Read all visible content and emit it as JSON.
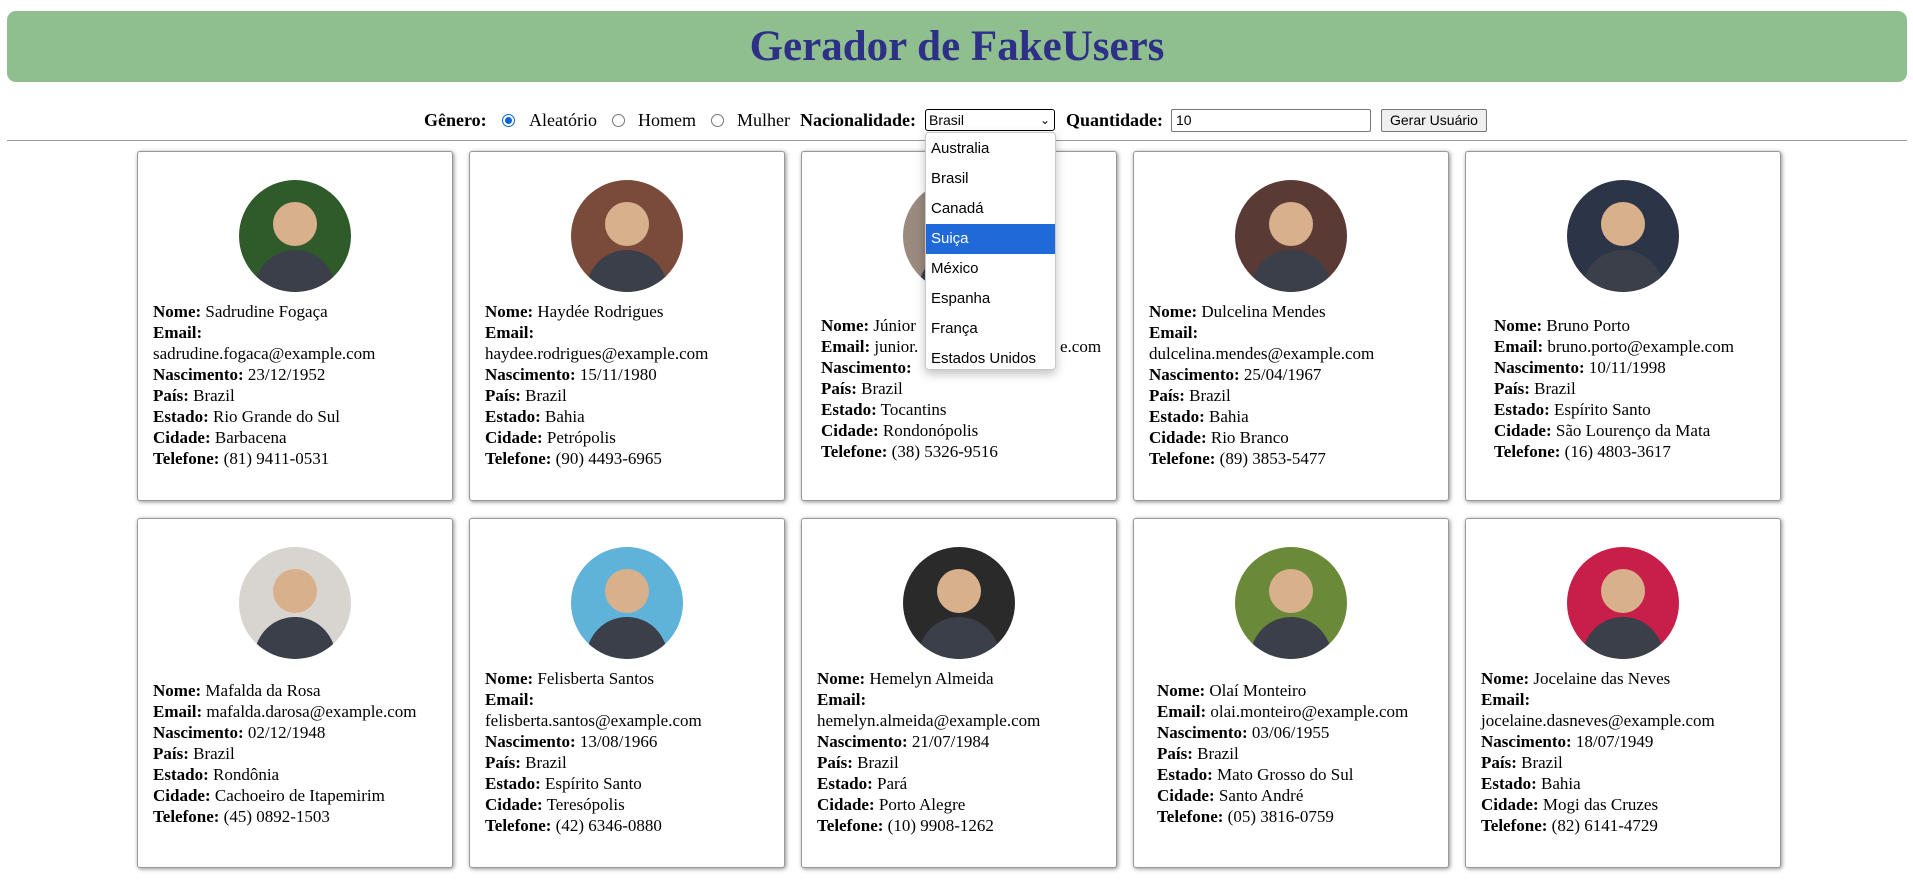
{
  "header": {
    "title": "Gerador de FakeUsers"
  },
  "controls": {
    "gender_label": "Gênero:",
    "gender_options": [
      "Aleatório",
      "Homem",
      "Mulher"
    ],
    "gender_selected": "Aleatório",
    "nationality_label": "Nacionalidade:",
    "nationality_value": "Brasil",
    "quantity_label": "Quantidade:",
    "quantity_value": "10",
    "generate_label": "Gerar Usuário"
  },
  "dropdown": {
    "options": [
      "Australia",
      "Brasil",
      "Canadá",
      "Suiça",
      "México",
      "Espanha",
      "França",
      "Estados Unidos"
    ],
    "highlighted": "Suiça"
  },
  "field_labels": {
    "name": "Nome:",
    "email": "Email:",
    "birth": "Nascimento:",
    "country": "País:",
    "state": "Estado:",
    "city": "Cidade:",
    "phone": "Telefone:"
  },
  "users": [
    {
      "name": "Sadrudine Fogaça",
      "email": "sadrudine.fogaca@example.com",
      "birth": "23/12/1952",
      "country": "Brazil",
      "state": "Rio Grande do Sul",
      "city": "Barbacena",
      "phone": "(81) 9411-0531",
      "email_wrap": true
    },
    {
      "name": "Haydée Rodrigues",
      "email": "haydee.rodrigues@example.com",
      "birth": "15/11/1980",
      "country": "Brazil",
      "state": "Bahia",
      "city": "Petrópolis",
      "phone": "(90) 4493-6965",
      "email_wrap": true
    },
    {
      "name": "Júnior",
      "email": "junior.",
      "email_tail": "e.com",
      "birth": "",
      "country": "Brazil",
      "state": "Tocantins",
      "city": "Rondonópolis",
      "phone": "(38) 5326-9516",
      "email_wrap": false
    },
    {
      "name": "Dulcelina Mendes",
      "email": "dulcelina.mendes@example.com",
      "birth": "25/04/1967",
      "country": "Brazil",
      "state": "Bahia",
      "city": "Rio Branco",
      "phone": "(89) 3853-5477",
      "email_wrap": true
    },
    {
      "name": "Bruno Porto",
      "email": "bruno.porto@example.com",
      "birth": "10/11/1998",
      "country": "Brazil",
      "state": "Espírito Santo",
      "city": "São Lourenço da Mata",
      "phone": "(16) 4803-3617",
      "email_wrap": false
    },
    {
      "name": "Mafalda da Rosa",
      "email": "mafalda.darosa@example.com",
      "birth": "02/12/1948",
      "country": "Brazil",
      "state": "Rondônia",
      "city": "Cachoeiro de Itapemirim",
      "phone": "(45) 0892-1503",
      "email_wrap": false
    },
    {
      "name": "Felisberta Santos",
      "email": "felisberta.santos@example.com",
      "birth": "13/08/1966",
      "country": "Brazil",
      "state": "Espírito Santo",
      "city": "Teresópolis",
      "phone": "(42) 6346-0880",
      "email_wrap": true
    },
    {
      "name": "Hemelyn Almeida",
      "email": "hemelyn.almeida@example.com",
      "birth": "21/07/1984",
      "country": "Brazil",
      "state": "Pará",
      "city": "Porto Alegre",
      "phone": "(10) 9908-1262",
      "email_wrap": true
    },
    {
      "name": "Olaí Monteiro",
      "email": "olai.monteiro@example.com",
      "birth": "03/06/1955",
      "country": "Brazil",
      "state": "Mato Grosso do Sul",
      "city": "Santo André",
      "phone": "(05) 3816-0759",
      "email_wrap": false
    },
    {
      "name": "Jocelaine das Neves",
      "email": "jocelaine.dasneves@example.com",
      "birth": "18/07/1949",
      "country": "Brazil",
      "state": "Bahia",
      "city": "Mogi das Cruzes",
      "phone": "(82) 6141-4729",
      "email_wrap": true
    }
  ],
  "avatar_colors": [
    "#2f5a2a",
    "#7a4a3a",
    "#9a8a80",
    "#5a3a35",
    "#2c3548",
    "#d8d4d0",
    "#5fb2d8",
    "#2a2a2a",
    "#6a8a3a",
    "#c81e4a"
  ]
}
